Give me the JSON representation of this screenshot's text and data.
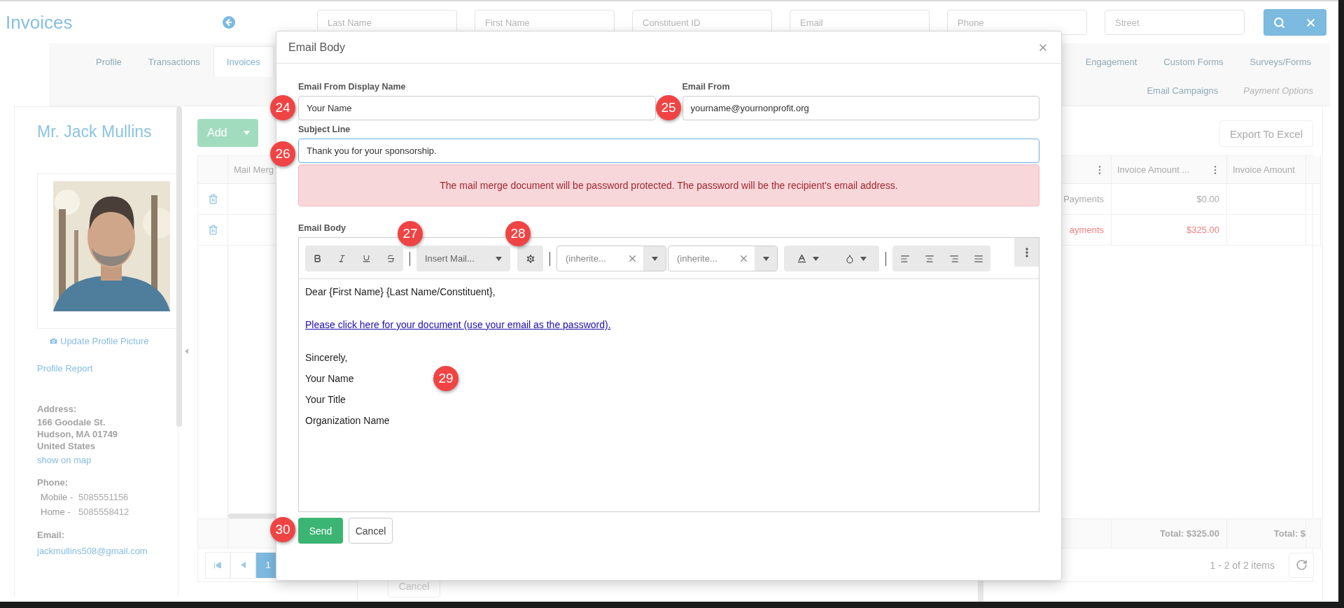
{
  "header": {
    "title": "Invoices",
    "search_fields": [
      {
        "placeholder": "Last Name"
      },
      {
        "placeholder": "First Name"
      },
      {
        "placeholder": "Constituent ID"
      },
      {
        "placeholder": "Email"
      },
      {
        "placeholder": "Phone"
      },
      {
        "placeholder": "Street"
      }
    ]
  },
  "tab_row_1": {
    "start": [
      {
        "label": "Profile",
        "selected": false
      },
      {
        "label": "Transactions",
        "selected": false
      },
      {
        "label": "Invoices",
        "selected": true
      }
    ],
    "end": [
      {
        "label": "Engagement",
        "selected": false
      },
      {
        "label": "Custom Forms",
        "selected": false
      },
      {
        "label": "Surveys/Forms",
        "selected": false
      }
    ]
  },
  "tab_row_2": [
    {
      "label": "Email Campaigns",
      "disabled": false
    },
    {
      "label": "Payment Options",
      "disabled": true
    }
  ],
  "profile": {
    "name": "Mr. Jack Mullins",
    "update_picture": "Update Profile Picture",
    "profile_report": "Profile Report",
    "address_label": "Address:",
    "address_lines": [
      "166 Goodale St.",
      "Hudson, MA 01749",
      "United States"
    ],
    "show_on_map": "show on map",
    "phone_label": "Phone:",
    "phones": [
      {
        "type": "Mobile -",
        "number": "5085551156"
      },
      {
        "type": "Home -",
        "number": "5085558412"
      }
    ],
    "email_label": "Email:",
    "email": "jackmullins508@gmail.com"
  },
  "grid": {
    "add_button": "Add",
    "export_button": "Export To Excel",
    "columns": {
      "column_2": "Mail Merg",
      "invoice_amount_1": "Invoice Amount ...",
      "invoice_amount_2": "Invoice Amount"
    },
    "rows": [
      {
        "column_3": "Payments",
        "invoice_amount": "$0.00",
        "highlighted": false
      },
      {
        "column_3": "ayments",
        "invoice_amount": "$325.00",
        "highlighted": true
      }
    ],
    "totals": [
      "Total: $325.00",
      "Total: $"
    ],
    "pages": [
      {
        "label": "1",
        "selected": true
      }
    ],
    "pager_info": "1 - 2 of 2 items"
  },
  "background_dialog": {
    "cancel_button": "Cancel"
  },
  "modal": {
    "title": "Email Body",
    "fields": [
      {
        "label": "Email From Display Name",
        "value": "Your Name"
      },
      {
        "label": "Email From",
        "value": "yourname@yournonprofit.org"
      }
    ],
    "subject": {
      "label": "Subject Line",
      "value": "Thank you for your sponsorship.",
      "focused": true
    },
    "alert": "The mail merge document will be password protected. The password will be the recipient's email address.",
    "body_label": "Email Body",
    "toolbar": {
      "merge_field": "Insert Mail...",
      "font_family": "(inherite...",
      "font_size": "(inherite..."
    },
    "body": [
      {
        "kind": "text",
        "text": "Dear {First Name} {Last Name/Constituent},"
      },
      {
        "kind": "link",
        "text": "Please click here for your document (use your email as the password)."
      },
      {
        "kind": "text",
        "text": "Sincerely,"
      },
      {
        "kind": "text",
        "text": "Your Name"
      },
      {
        "kind": "text",
        "text": "Your Title"
      },
      {
        "kind": "text",
        "text": "Organization Name"
      }
    ],
    "send_button": "Send",
    "cancel_button": "Cancel"
  },
  "annotations": [
    {
      "number": "24"
    },
    {
      "number": "25"
    },
    {
      "number": "26"
    },
    {
      "number": "27"
    },
    {
      "number": "28"
    },
    {
      "number": "29"
    },
    {
      "number": "30"
    }
  ]
}
